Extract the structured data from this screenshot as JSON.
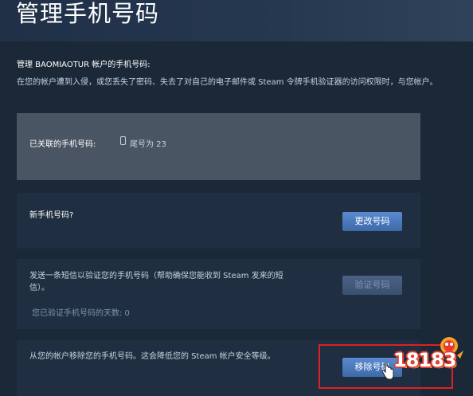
{
  "header": {
    "title": "管理手机号码"
  },
  "intro": {
    "manage_label": "管理 BAOMIAOTUR 帐户的手机号码:",
    "description": "在您的帐户遭到入侵，或您丢失了密码、失去了对自己的电子邮件或 Steam 令牌手机验证器的访问权限时，与您帐户。"
  },
  "linked_panel": {
    "label": "已关联的手机号码:",
    "tail": "尾号为 23",
    "icon": "phone-icon"
  },
  "new_phone_panel": {
    "label": "新手机号码?",
    "button": "更改号码"
  },
  "verify_panel": {
    "text": "发送一条短信以验证您的手机号码（帮助确保您能收到 Steam 发来的短信）。",
    "button": "验证号码",
    "days": "您已验证手机号码的天数:  0"
  },
  "remove_panel": {
    "text": "从您的帐户移除您的手机号码。这会降低您的 Steam 帐户安全等级。",
    "button": "移除号码"
  },
  "watermark": {
    "text": "18183"
  },
  "colors": {
    "background": "#1b2838",
    "button_blue": "#4a7bc0",
    "highlight_red": "#e02020"
  }
}
